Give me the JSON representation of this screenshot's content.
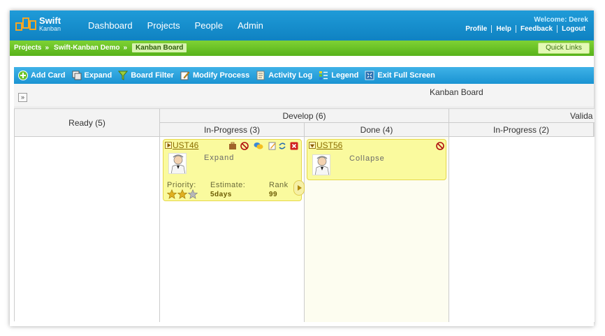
{
  "app": {
    "logo_name": "Swift",
    "logo_sub": "Kanban"
  },
  "nav": [
    "Dashboard",
    "Projects",
    "People",
    "Admin"
  ],
  "user": {
    "welcome": "Welcome: Derek",
    "links": [
      "Profile",
      "Help",
      "Feedback",
      "Logout"
    ]
  },
  "breadcrumb": [
    "Projects",
    "Swift-Kanban Demo",
    "Kanban Board"
  ],
  "quick_links": "Quick Links",
  "toolbar": [
    "Add Card",
    "Expand",
    "Board Filter",
    "Modify Process",
    "Activity Log",
    "Legend",
    "Exit Full Screen"
  ],
  "board": {
    "title": "Kanban Board",
    "expand_glyph": "»",
    "columns": {
      "ready": "Ready (5)",
      "develop": "Develop (6)",
      "develop_inprogress": "In-Progress (3)",
      "develop_done": "Done (4)",
      "validate": "Valida",
      "validate_inprogress": "In-Progress (2)"
    }
  },
  "cards": [
    {
      "id": "UST46",
      "action": "Expand",
      "priority_label": "Priority:",
      "estimate_label": "Estimate:",
      "estimate_value": "5days",
      "rank_label": "Rank",
      "rank_value": "99",
      "priority_stars": 2,
      "priority_max": 3
    },
    {
      "id": "UST56",
      "action": "Collapse"
    }
  ],
  "colors": {
    "header_blue": "#1a8fcf",
    "green_bar": "#62bb22",
    "card_yellow": "#fafa9e",
    "card_border": "#e6d84a"
  }
}
